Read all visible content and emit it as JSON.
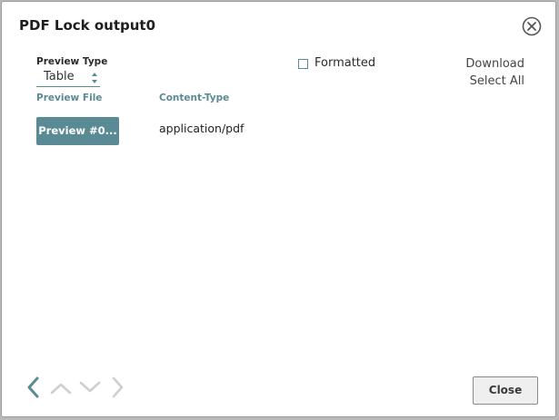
{
  "dialog": {
    "title": "PDF Lock output0"
  },
  "preview_type": {
    "label": "Preview Type",
    "selected": "Table"
  },
  "formatted": {
    "label": "Formatted",
    "checked": false
  },
  "actions": {
    "download": "Download",
    "select_all": "Select All"
  },
  "table": {
    "headers": [
      "Preview File",
      "Content-Type"
    ],
    "rows": [
      {
        "preview_button": "Preview #0...",
        "content_type": "application/pdf"
      }
    ]
  },
  "footer": {
    "close_label": "Close"
  },
  "colors": {
    "accent": "#5a8a94",
    "nav_active": "#5a8a94",
    "nav_disabled": "#cfcfcf"
  }
}
